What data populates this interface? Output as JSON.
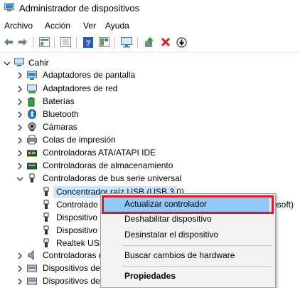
{
  "window": {
    "title": "Administrador de dispositivos"
  },
  "menu": {
    "items": [
      "Archivo",
      "Acción",
      "Ver",
      "Ayuda"
    ]
  },
  "toolbar": {
    "icons": [
      "back-icon",
      "forward-icon",
      "properties-icon",
      "device-list-icon",
      "help-icon",
      "view-icon",
      "monitor-icon",
      "update-driver-icon",
      "uninstall-icon",
      "download-icon"
    ]
  },
  "tree": {
    "root": "Cahir",
    "categories": [
      "Adaptadores de pantalla",
      "Adaptadores de red",
      "Baterías",
      "Bluetooth",
      "Cámaras",
      "Colas de impresión",
      "Controladoras ATA/ATAPI IDE",
      "Controladoras de almacenamiento",
      "Controladoras de bus serie universal"
    ],
    "usb_children": [
      "Concentrador raíz USB (USB 3.0)",
      "Controlado",
      "Dispositivo",
      "Dispositivo",
      "Realtek USB"
    ],
    "usb_child_suffix": "osoft)",
    "after_categories": [
      "Controladoras de",
      "Dispositivos de",
      "Dispositivos de"
    ]
  },
  "context_menu": {
    "items": [
      "Actualizar controlador",
      "Deshabilitar dispositivo",
      "Desinstalar el dispositivo",
      "Buscar cambios de hardware",
      "Propiedades"
    ]
  },
  "colors": {
    "highlight": "#91c9f7",
    "annotation": "#e0162b",
    "selection": "#cce8ff"
  }
}
